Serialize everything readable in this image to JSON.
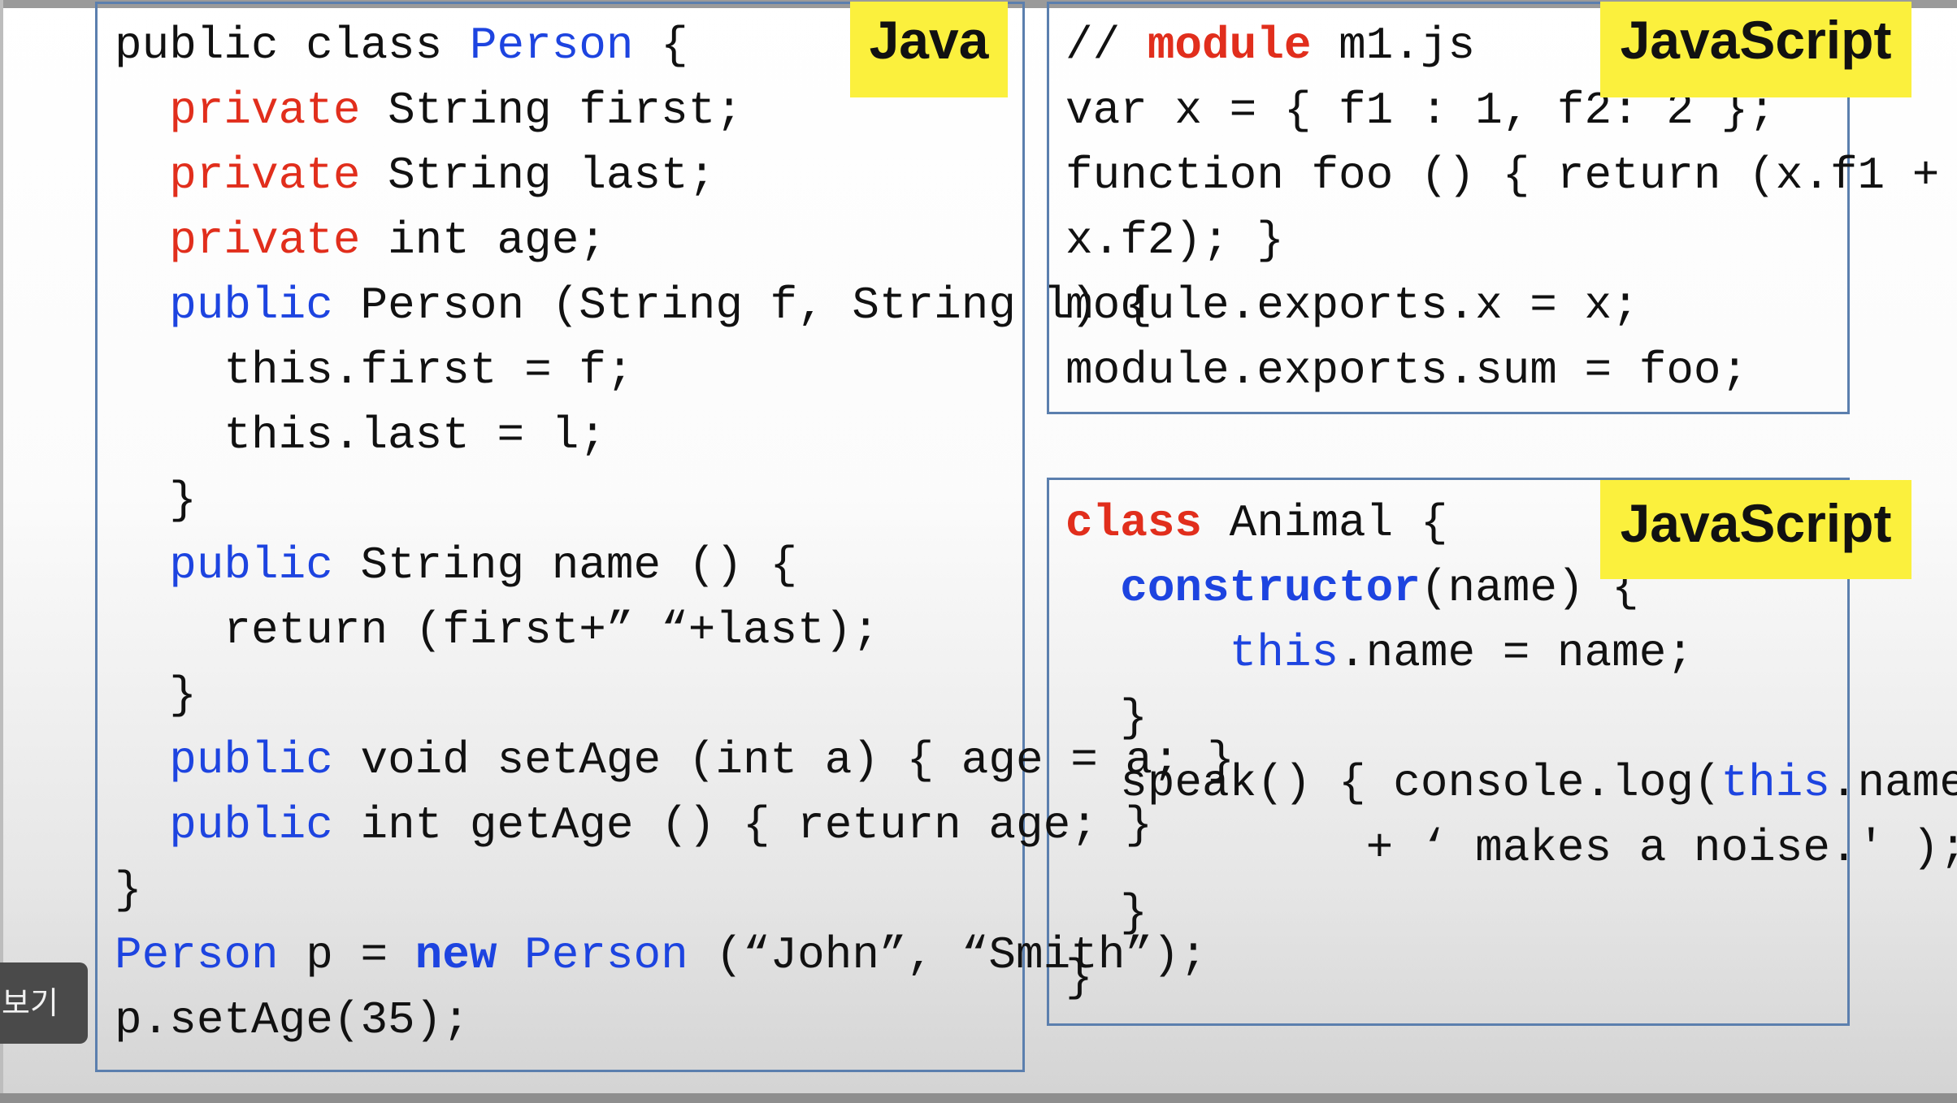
{
  "java": {
    "badge": "Java",
    "lines": [
      [
        {
          "t": "public class ",
          "c": ""
        },
        {
          "t": "Person",
          "c": "kw-blue"
        },
        {
          "t": " {",
          "c": ""
        }
      ],
      [
        {
          "t": "  ",
          "c": ""
        },
        {
          "t": "private",
          "c": "kw-red"
        },
        {
          "t": " String first;",
          "c": ""
        }
      ],
      [
        {
          "t": "  ",
          "c": ""
        },
        {
          "t": "private",
          "c": "kw-red"
        },
        {
          "t": " String last;",
          "c": ""
        }
      ],
      [
        {
          "t": "  ",
          "c": ""
        },
        {
          "t": "private",
          "c": "kw-red"
        },
        {
          "t": " int age;",
          "c": ""
        }
      ],
      [
        {
          "t": "  ",
          "c": ""
        },
        {
          "t": "public",
          "c": "kw-blue"
        },
        {
          "t": " Person (String f, String l) {",
          "c": ""
        }
      ],
      [
        {
          "t": "    this.first = f;",
          "c": ""
        }
      ],
      [
        {
          "t": "    this.last = l;",
          "c": ""
        }
      ],
      [
        {
          "t": "  }",
          "c": ""
        }
      ],
      [
        {
          "t": "  ",
          "c": ""
        },
        {
          "t": "public",
          "c": "kw-blue"
        },
        {
          "t": " String name () {",
          "c": ""
        }
      ],
      [
        {
          "t": "    return (first+” “+last);",
          "c": ""
        }
      ],
      [
        {
          "t": "  }",
          "c": ""
        }
      ],
      [
        {
          "t": "  ",
          "c": ""
        },
        {
          "t": "public",
          "c": "kw-blue"
        },
        {
          "t": " void setAge (int a) { age = a; }",
          "c": ""
        }
      ],
      [
        {
          "t": "  ",
          "c": ""
        },
        {
          "t": "public",
          "c": "kw-blue"
        },
        {
          "t": " int getAge () { return age; }",
          "c": ""
        }
      ],
      [
        {
          "t": "}",
          "c": ""
        }
      ],
      [
        {
          "t": "Person",
          "c": "kw-blue"
        },
        {
          "t": " p = ",
          "c": ""
        },
        {
          "t": "new",
          "c": "kw-blue bold"
        },
        {
          "t": " ",
          "c": ""
        },
        {
          "t": "Person",
          "c": "kw-blue"
        },
        {
          "t": " (“John”, “Smith”);",
          "c": ""
        }
      ],
      [
        {
          "t": "p.setAge(35);",
          "c": ""
        }
      ]
    ]
  },
  "js_module": {
    "badge": "JavaScript",
    "lines": [
      [
        {
          "t": "// ",
          "c": ""
        },
        {
          "t": "module",
          "c": "kw-red bold"
        },
        {
          "t": " m1.js",
          "c": ""
        }
      ],
      [
        {
          "t": "var x = { f1 : 1, f2: 2 };",
          "c": ""
        }
      ],
      [
        {
          "t": "function foo () { return (x.f1 +",
          "c": ""
        }
      ],
      [
        {
          "t": "x.f2); }",
          "c": ""
        }
      ],
      [
        {
          "t": "module.exports.x = x;",
          "c": ""
        }
      ],
      [
        {
          "t": "module.exports.sum = foo;",
          "c": ""
        }
      ]
    ]
  },
  "js_class": {
    "badge": "JavaScript",
    "lines": [
      [
        {
          "t": "class",
          "c": "kw-red bold"
        },
        {
          "t": " Animal {",
          "c": ""
        }
      ],
      [
        {
          "t": "  ",
          "c": ""
        },
        {
          "t": "constructor",
          "c": "kw-blue bold"
        },
        {
          "t": "(name) {",
          "c": ""
        }
      ],
      [
        {
          "t": "      ",
          "c": ""
        },
        {
          "t": "this",
          "c": "kw-blue"
        },
        {
          "t": ".name = name;",
          "c": ""
        }
      ],
      [
        {
          "t": "  }",
          "c": ""
        }
      ],
      [
        {
          "t": "  speak() { console.log(",
          "c": ""
        },
        {
          "t": "this",
          "c": "kw-blue"
        },
        {
          "t": ".name",
          "c": ""
        }
      ],
      [
        {
          "t": "           + ‘ makes a noise.' );",
          "c": ""
        }
      ],
      [
        {
          "t": "  }",
          "c": ""
        }
      ],
      [
        {
          "t": "}",
          "c": ""
        }
      ]
    ]
  },
  "overlay": {
    "side_button_label": "보기"
  }
}
